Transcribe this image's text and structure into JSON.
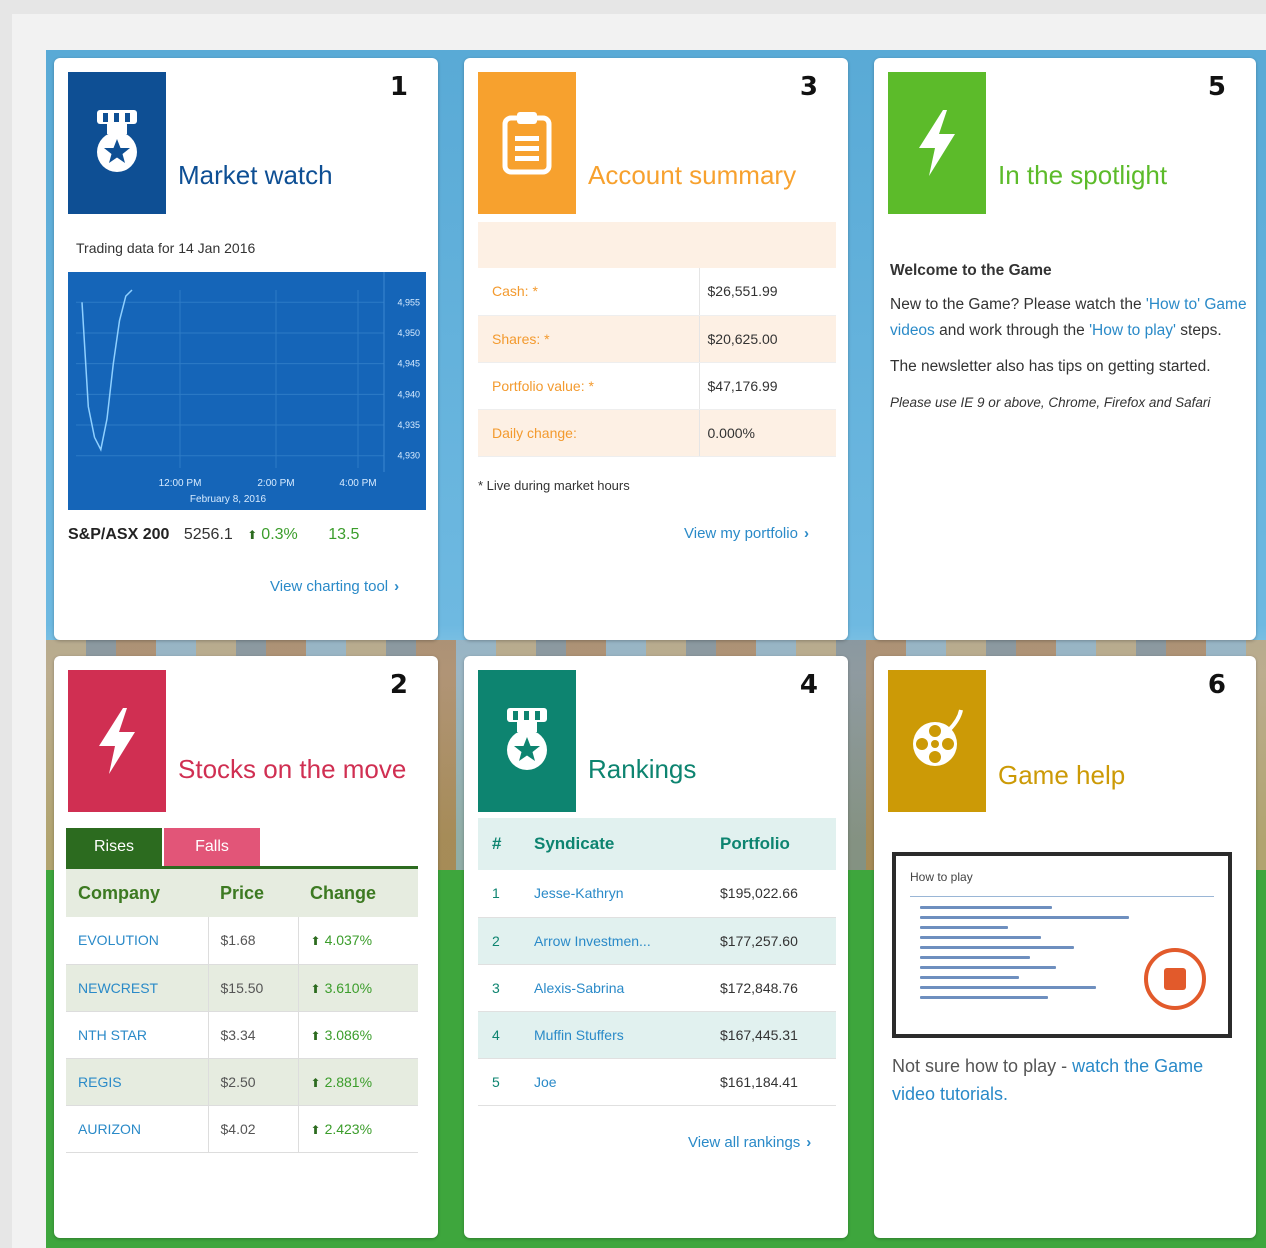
{
  "colors": {
    "market_watch": "#0e4f94",
    "account_summary": "#f7a12e",
    "spotlight": "#5cbb2a",
    "stocks": "#d02f52",
    "rankings": "#0d8470",
    "game_help": "#cc9a06",
    "link": "#2a8ac8"
  },
  "market_watch": {
    "number": "1",
    "icon": "medal-icon",
    "title": "Market watch",
    "date_label": "Trading data for 14 Jan 2016",
    "chart_data": {
      "type": "line",
      "y_ticks": [
        "4,955",
        "4,950",
        "4,945",
        "4,940",
        "4,935",
        "4,930"
      ],
      "x_ticks": [
        "12:00 PM",
        "2:00 PM",
        "4:00 PM"
      ],
      "x_sublabel": "February 8, 2016",
      "x": [
        0,
        1,
        2,
        3,
        4,
        5,
        6,
        7,
        8
      ],
      "y": [
        4955,
        4938,
        4933,
        4931,
        4936,
        4945,
        4952,
        4956,
        4957
      ]
    },
    "ticker": {
      "index": "S&P/ASX 200",
      "value": "5256.1",
      "pct": "0.3%",
      "points": "13.5"
    },
    "link": "View charting tool"
  },
  "account_summary": {
    "number": "3",
    "icon": "clipboard-icon",
    "title": "Account summary",
    "rows": [
      {
        "label": "Cash: *",
        "value": "$26,551.99"
      },
      {
        "label": "Shares: *",
        "value": "$20,625.00"
      },
      {
        "label": "Portfolio value: *",
        "value": "$47,176.99"
      },
      {
        "label": "Daily change:",
        "value": "0.000%"
      }
    ],
    "note": "* Live during market hours",
    "link": "View my portfolio"
  },
  "spotlight": {
    "number": "5",
    "icon": "lightning-icon",
    "title": "In the spotlight",
    "heading": "Welcome to the Game",
    "p1_a": "New to the Game? Please watch the ",
    "p1_link1": "'How to' Game videos",
    "p1_b": " and work through the ",
    "p1_link2": "'How to play'",
    "p1_c": " steps.",
    "p2": "The newsletter also has tips on getting started.",
    "p3": "Please use IE 9 or above, Chrome, Firefox and Safari"
  },
  "stocks": {
    "number": "2",
    "icon": "lightning-icon",
    "title": "Stocks on the move",
    "tabs": [
      "Rises",
      "Falls"
    ],
    "headers": [
      "Company",
      "Price",
      "Change"
    ],
    "rows": [
      {
        "company": "EVOLUTION",
        "price": "$1.68",
        "change": "4.037%"
      },
      {
        "company": "NEWCREST",
        "price": "$15.50",
        "change": "3.610%"
      },
      {
        "company": "NTH STAR",
        "price": "$3.34",
        "change": "3.086%"
      },
      {
        "company": "REGIS",
        "price": "$2.50",
        "change": "2.881%"
      },
      {
        "company": "AURIZON",
        "price": "$4.02",
        "change": "2.423%"
      }
    ]
  },
  "rankings": {
    "number": "4",
    "icon": "medal-icon",
    "title": "Rankings",
    "headers": [
      "#",
      "Syndicate",
      "Portfolio"
    ],
    "rows": [
      {
        "rank": "1",
        "syndicate": "Jesse-Kathryn",
        "portfolio": "$195,022.66"
      },
      {
        "rank": "2",
        "syndicate": "Arrow Investmen...",
        "portfolio": "$177,257.60"
      },
      {
        "rank": "3",
        "syndicate": "Alexis-Sabrina",
        "portfolio": "$172,848.76"
      },
      {
        "rank": "4",
        "syndicate": "Muffin Stuffers",
        "portfolio": "$167,445.31"
      },
      {
        "rank": "5",
        "syndicate": "Joe",
        "portfolio": "$161,184.41"
      }
    ],
    "link": "View all rankings"
  },
  "game_help": {
    "number": "6",
    "icon": "film-reel-icon",
    "title": "Game help",
    "video_title": "How to play",
    "text_a": "Not sure how to play - ",
    "text_link": "watch the Game video tutorials."
  }
}
